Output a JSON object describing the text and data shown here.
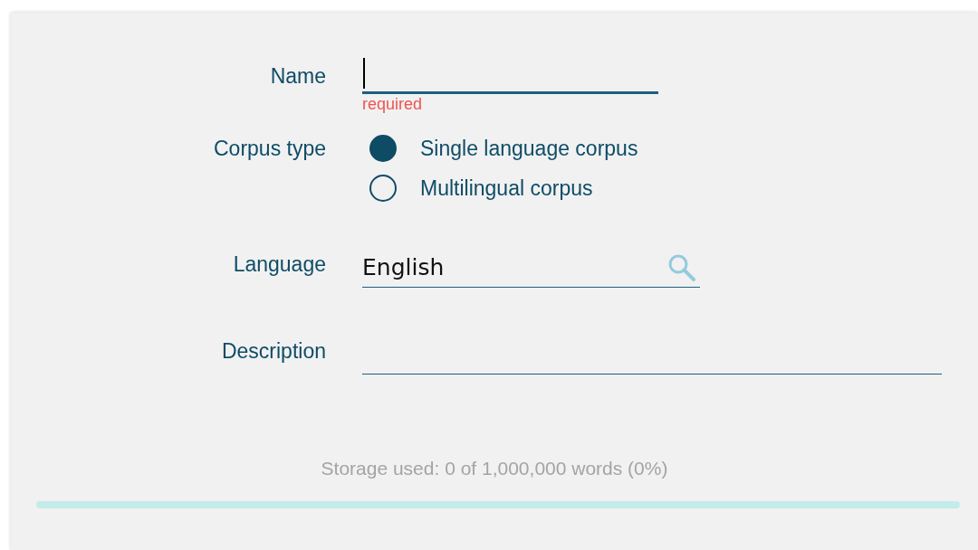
{
  "form": {
    "name": {
      "label": "Name",
      "focused": true,
      "error": "required"
    },
    "corpus_type": {
      "label": "Corpus type",
      "options": [
        {
          "label": "Single language corpus",
          "selected": true
        },
        {
          "label": "Multilingual corpus",
          "selected": false
        }
      ]
    },
    "language": {
      "label": "Language",
      "value": "English"
    },
    "description": {
      "label": "Description"
    }
  },
  "storage": {
    "text": "Storage used: 0 of 1,000,000 words (0%)",
    "level": 0
  }
}
